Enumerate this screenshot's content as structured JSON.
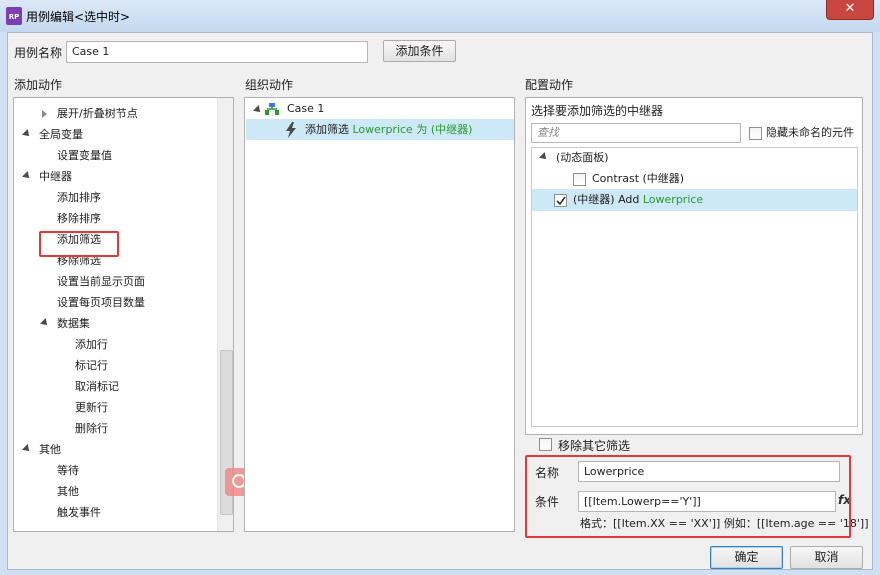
{
  "window": {
    "title": "用例编辑<选中时>",
    "app_icon_text": "RP",
    "close": "✕"
  },
  "case_name": {
    "label": "用例名称",
    "value": "Case 1",
    "add_condition": "添加条件"
  },
  "left": {
    "header": "添加动作",
    "items": [
      {
        "label": "展开/折叠树节点",
        "indent": 2
      },
      {
        "label": "全局变量",
        "indent": 1,
        "expand": "open"
      },
      {
        "label": "设置变量值",
        "indent": 2
      },
      {
        "label": "中继器",
        "indent": 1,
        "expand": "open"
      },
      {
        "label": "添加排序",
        "indent": 2
      },
      {
        "label": "移除排序",
        "indent": 2
      },
      {
        "label": "添加筛选",
        "indent": 2
      },
      {
        "label": "移除筛选",
        "indent": 2
      },
      {
        "label": "设置当前显示页面",
        "indent": 2
      },
      {
        "label": "设置每页项目数量",
        "indent": 2
      },
      {
        "label": "数据集",
        "indent": 2,
        "expand": "open"
      },
      {
        "label": "添加行",
        "indent": 3
      },
      {
        "label": "标记行",
        "indent": 3
      },
      {
        "label": "取消标记",
        "indent": 3
      },
      {
        "label": "更新行",
        "indent": 3
      },
      {
        "label": "删除行",
        "indent": 3
      },
      {
        "label": "其他",
        "indent": 1,
        "expand": "open"
      },
      {
        "label": "等待",
        "indent": 2
      },
      {
        "label": "其他",
        "indent": 2
      },
      {
        "label": "触发事件",
        "indent": 2
      }
    ]
  },
  "middle": {
    "header": "组织动作",
    "case": "Case 1",
    "action_prefix": "添加筛选 ",
    "action_target": "Lowerprice",
    "action_suffix": " 为 (中继器)"
  },
  "right": {
    "header": "配置动作",
    "subheader": "选择要添加筛选的中继器",
    "search_placeholder": "查找",
    "hide_unnamed": "隐藏未命名的元件",
    "tree": {
      "dynamic_panel": "(动态面板)",
      "contrast": "Contrast (中继器)",
      "selected_prefix": "(中继器) Add ",
      "selected_target": "Lowerprice"
    },
    "remove_other": "移除其它筛选",
    "name_label": "名称",
    "name_value": "Lowerprice",
    "condition_label": "条件",
    "condition_value": "[[Item.Lowerp=='Y']]",
    "fx": "fx",
    "format_hint": "格式：[[Item.XX == 'XX']] 例如：[[Item.age == '18']]"
  },
  "footer": {
    "ok": "确定",
    "cancel": "取消"
  },
  "colors": {
    "selected_row": "#cde8f7",
    "highlight": "#e23a3a",
    "green": "#2a9a2a"
  }
}
